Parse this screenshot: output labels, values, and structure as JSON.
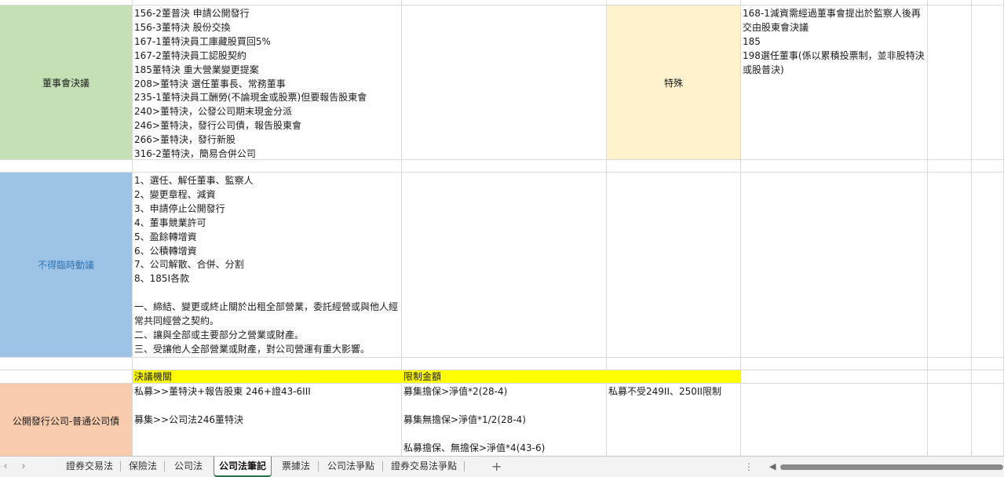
{
  "rows": {
    "board": {
      "label": "董事會決議",
      "lines": [
        "156-2董普決 申請公開發行",
        "156-3董特決 股份交換",
        "167-1董特決員工庫藏股買回5%",
        "167-2董特決員工認股契約",
        "185董特決 重大營業變更提案",
        "208>董特決 選任董事長、常務董事",
        "235-1董特決員工酬勞(不論現金或股票)但要報告股東會",
        "240>董特決，公發公司期末現金分派",
        "246>董特決，發行公司債，報告股東會",
        "266>董特決，發行新股",
        "316-2董特決，簡易合併公司"
      ],
      "special_label": "特殊",
      "special_lines": [
        "168-1減資需經過董事會提出於監察人後再交由股東會決議",
        "185",
        "198選任董事(係以累積投票制，並非股特決或股普決)"
      ]
    },
    "noTemp": {
      "label": "不得臨時動議",
      "lines": [
        "1、選任、解任董事、監察人",
        "2、變更章程、減資",
        "3、申請停止公開發行",
        "4、董事競業許可",
        "5、盈餘轉增資",
        "6、公積轉增資",
        "7、公司解散、合併、分割",
        "8、185I各款",
        "",
        "一、締結、變更或終止關於出租全部營業，委託經營或與他人經常共同經營之契約。",
        "二、讓與全部或主要部分之營業或財產。",
        "三、受讓他人全部營業或財產，對公司營運有重大影響。"
      ]
    },
    "bond": {
      "header_authority": "決議機關",
      "header_limit": "限制金額",
      "label": "公開發行公司-普通公司債",
      "authority_lines": [
        "私募>>董特決+報告股東 246+證43-6III",
        "",
        "募集>>公司法246董特決"
      ],
      "limit_lines": [
        "募集擔保>淨值*2(28-4)",
        "",
        "募集無擔保>淨值*1/2(28-4)",
        "",
        "私募擔保、無擔保>淨值*4(43-6)"
      ],
      "note": "私募不受249II、250II限制"
    }
  },
  "sheet_tabs": [
    "證券交易法",
    "保險法",
    "公司法",
    "公司法筆記",
    "票據法",
    "公司法爭點",
    "證券交易法爭點"
  ],
  "active_tab_index": 3,
  "icons": {
    "prev": "‹",
    "next": "›",
    "add": "+",
    "more": "⋮",
    "scroll_left": "◀"
  }
}
